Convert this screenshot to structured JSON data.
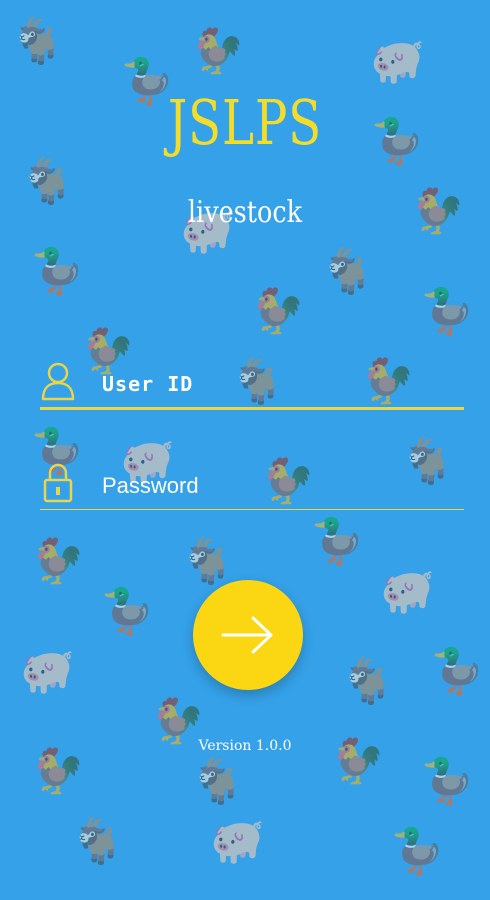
{
  "app": {
    "title": "JSLPS",
    "subtitle": "livestock"
  },
  "login": {
    "user_placeholder": "User ID",
    "password_placeholder": "Password",
    "user_value": "",
    "password_value": ""
  },
  "icons": {
    "user": "user-outline-icon",
    "password": "padlock-icon",
    "submit": "arrow-right-icon"
  },
  "footer": {
    "version": "Version 1.0.0"
  },
  "colors": {
    "background": "#35a1e8",
    "accent": "#f3dd2a",
    "button": "#fbd612",
    "text": "#ffffff"
  }
}
